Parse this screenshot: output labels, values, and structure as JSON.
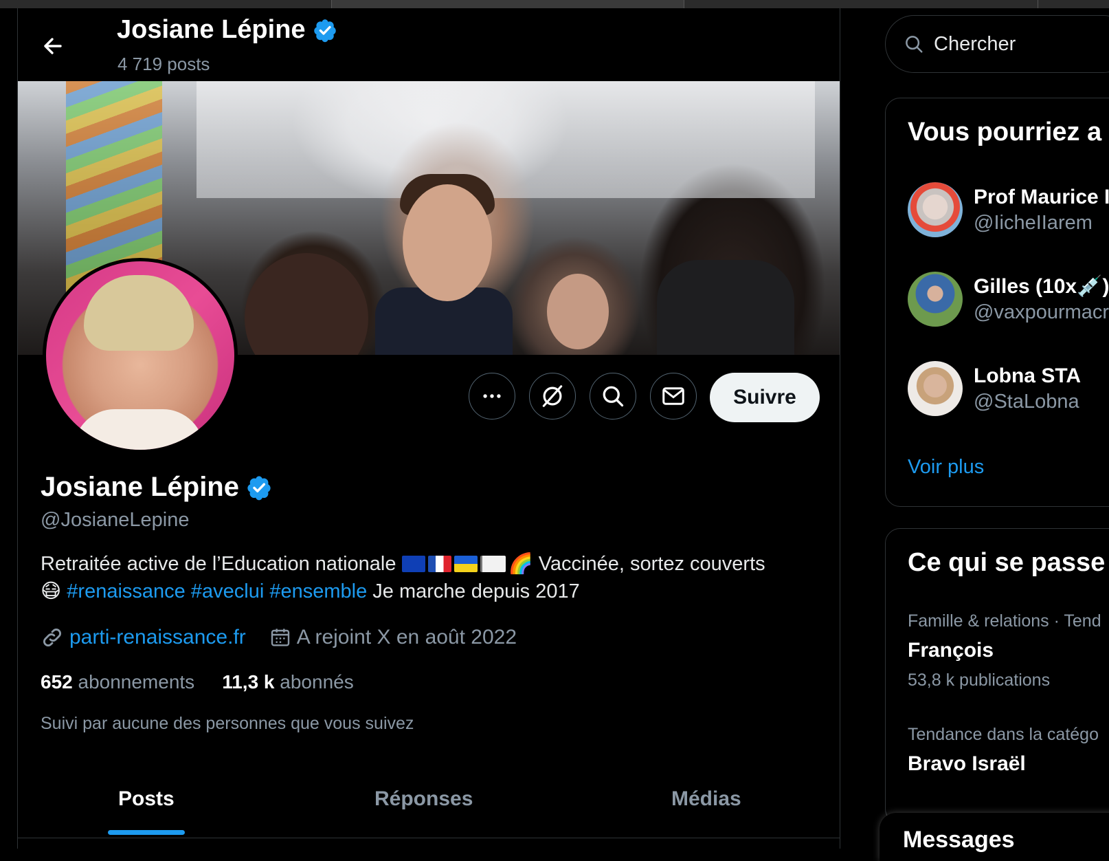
{
  "header": {
    "name": "Josiane Lépine",
    "post_count": "4 719 posts"
  },
  "profile": {
    "name": "Josiane Lépine",
    "handle": "@JosianeLepine",
    "bio_text_1": "Retraitée active de l’Education nationale",
    "bio_text_2": "Vaccinée, sortez couverts",
    "bio_emoji_rainbow": "🌈",
    "bio_emoji_mask": "😷",
    "hashtags": [
      "#renaissance",
      "#aveclui",
      "#ensemble"
    ],
    "bio_text_3": "Je marche depuis 2017",
    "website": "parti-renaissance.fr",
    "joined": "A rejoint X en août 2022",
    "following_count": "652",
    "following_label": "abonnements",
    "followers_count": "11,3 k",
    "followers_label": "abonnés",
    "followed_by": "Suivi par aucune des personnes que vous suivez"
  },
  "actions": {
    "follow_label": "Suivre"
  },
  "tabs": [
    {
      "label": "Posts",
      "active": true
    },
    {
      "label": "Réponses",
      "active": false
    },
    {
      "label": "Médias",
      "active": false
    }
  ],
  "search": {
    "placeholder": "Chercher"
  },
  "suggestions": {
    "title": "Vous pourriez a",
    "items": [
      {
        "name": "Prof Maurice I",
        "handle": "@IicheIIarem"
      },
      {
        "name": "Gilles (10x💉)",
        "handle": "@vaxpourmacr"
      },
      {
        "name": "Lobna STA",
        "handle": "@StaLobna"
      }
    ],
    "see_more": "Voir plus"
  },
  "trends": {
    "title": "Ce qui se passe",
    "items": [
      {
        "category": "Famille & relations · Tend",
        "name": "François",
        "count": "53,8 k publications"
      },
      {
        "category": "Tendance dans la catégo",
        "name": "Bravo Israël"
      }
    ]
  },
  "messages": {
    "title": "Messages"
  },
  "colors": {
    "accent": "#1d9bf0",
    "background": "#000000",
    "secondary_text": "#8b98a5",
    "border": "#2f3336"
  }
}
